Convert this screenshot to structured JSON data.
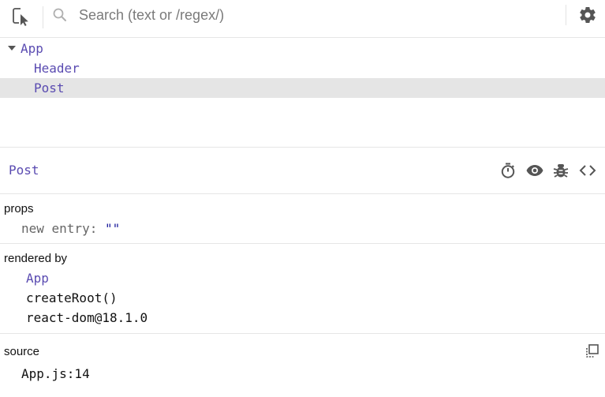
{
  "search": {
    "placeholder": "Search (text or /regex/)",
    "value": ""
  },
  "tree": {
    "items": [
      {
        "label": "App",
        "expanded": true,
        "depth": 0
      },
      {
        "label": "Header",
        "depth": 1
      },
      {
        "label": "Post",
        "depth": 1,
        "selected": true
      }
    ]
  },
  "selected": {
    "name": "Post"
  },
  "icons": {
    "inspect": "inspect-element-icon",
    "search": "search-icon",
    "settings": "gear-icon",
    "suspend": "stopwatch-icon",
    "inspect_dom": "eye-icon",
    "log": "bug-icon",
    "view_source": "code-brackets-icon",
    "copy": "copy-icon"
  },
  "props": {
    "title": "props",
    "new_entry_key": "new entry",
    "colon": ":",
    "new_entry_value": "\"\""
  },
  "rendered_by": {
    "title": "rendered by",
    "owners": [
      "App",
      "createRoot()",
      "react-dom@18.1.0"
    ]
  },
  "source": {
    "title": "source",
    "location": "App.js:14"
  },
  "colors": {
    "component": "#5a4bb1",
    "selection_bg": "#e5e5e5",
    "string_value": "#1f1f9e"
  }
}
